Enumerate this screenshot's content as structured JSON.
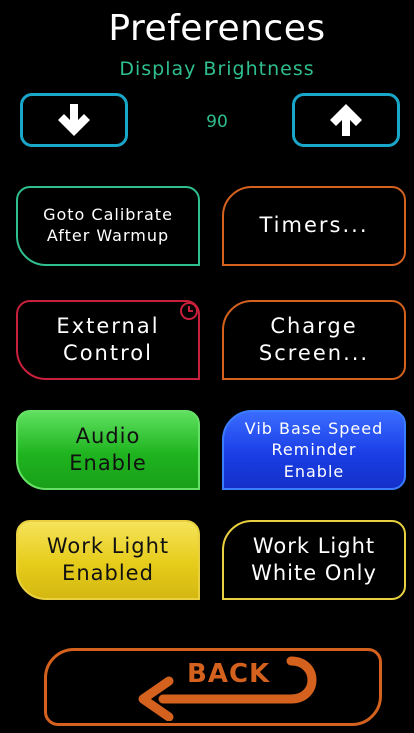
{
  "header": {
    "title": "Preferences",
    "subtitle": "Display Brightness"
  },
  "brightness": {
    "value": "90",
    "decrease_icon": "arrow-down-icon",
    "increase_icon": "arrow-up-icon"
  },
  "buttons": {
    "goto_calibrate": {
      "line1": "Goto Calibrate",
      "line2": "After Warmup"
    },
    "timers": {
      "label": "Timers..."
    },
    "external_control": {
      "line1": "External",
      "line2": "Control"
    },
    "charge_screen": {
      "line1": "Charge",
      "line2": "Screen..."
    },
    "audio_enable": {
      "line1": "Audio",
      "line2": "Enable"
    },
    "vib_base_speed": {
      "line1": "Vib Base Speed",
      "line2": "Reminder",
      "line3": "Enable"
    },
    "work_light_enabled": {
      "line1": "Work Light",
      "line2": "Enabled"
    },
    "work_light_white": {
      "line1": "Work Light",
      "line2": "White Only"
    }
  },
  "back": {
    "label": "BACK",
    "icon": "back-arrow-icon"
  },
  "colors": {
    "teal": "#2fbf8f",
    "cyan": "#1aa6c8",
    "orange": "#d4621e",
    "red": "#c8203c",
    "green": "#1fb41f",
    "blue": "#1a3ee6",
    "yellow": "#e6cc1a"
  }
}
